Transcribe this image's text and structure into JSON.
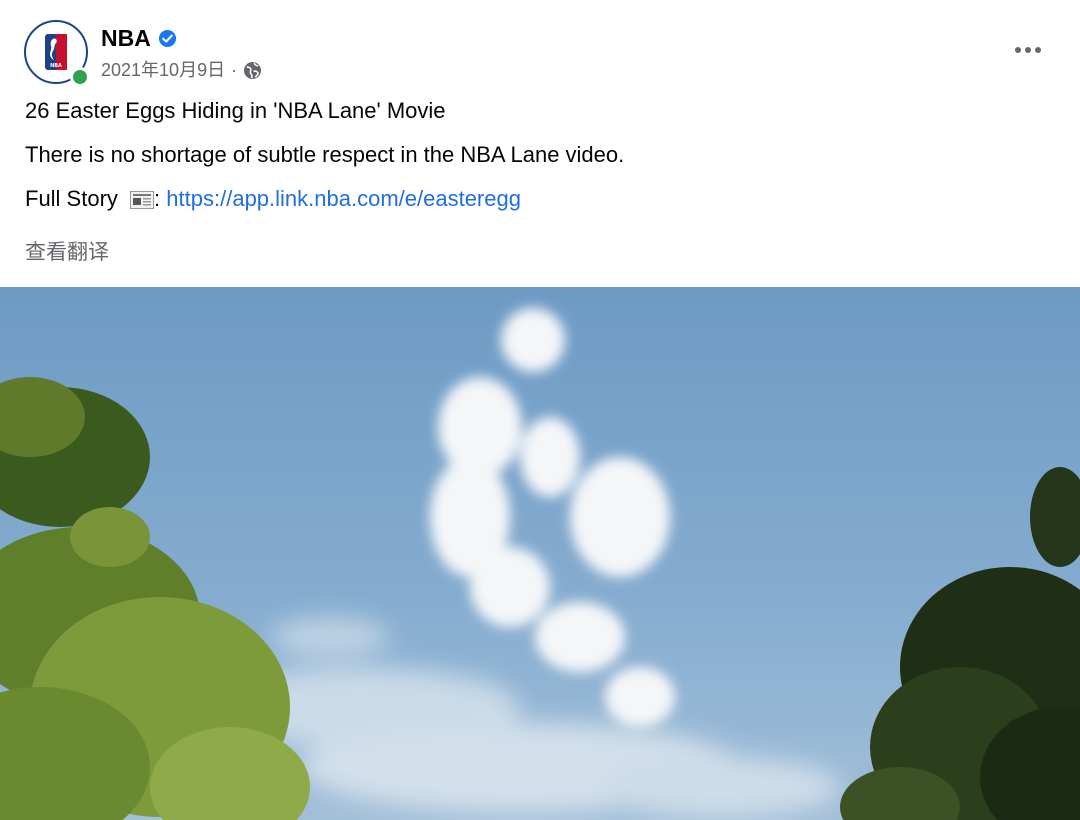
{
  "post": {
    "page_name": "NBA",
    "date": "2021年10月9日",
    "separator": "·",
    "privacy_icon": "globe-icon",
    "verified_icon": "verified-badge-icon",
    "title_line": "26 Easter Eggs Hiding in 'NBA Lane' Movie",
    "body_line": "There is no shortage of subtle respect in the NBA Lane video.",
    "story_label": "Full Story",
    "story_icon": "newspaper-icon",
    "story_colon": ":",
    "link_text": "https://app.link.nba.com/e/easteregg",
    "see_translation": "查看翻译"
  },
  "colors": {
    "link": "#216fdb",
    "secondary_text": "#65676b",
    "online": "#31a24c",
    "verified": "#1877f2",
    "nba_blue": "#1d428a",
    "nba_red": "#c8102e",
    "sky": "#7fa8cc"
  },
  "media": {
    "description_icon": "photo-sky-cloud-logo"
  }
}
